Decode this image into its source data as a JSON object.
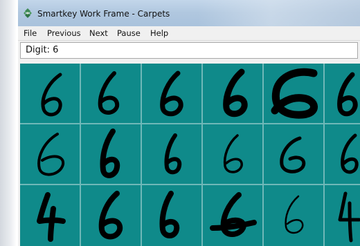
{
  "window": {
    "title": "Smartkey Work Frame - Carpets",
    "icon": "smartkey-app-icon"
  },
  "menu": {
    "items": [
      "File",
      "Previous",
      "Next",
      "Pause",
      "Help"
    ]
  },
  "digit_field": {
    "text": "Digit: 6"
  },
  "samples": {
    "rows": 3,
    "columns_visible": 6,
    "digit_shown": "6",
    "cell_color": "#0f8a8a",
    "ink_color": "#000000"
  }
}
